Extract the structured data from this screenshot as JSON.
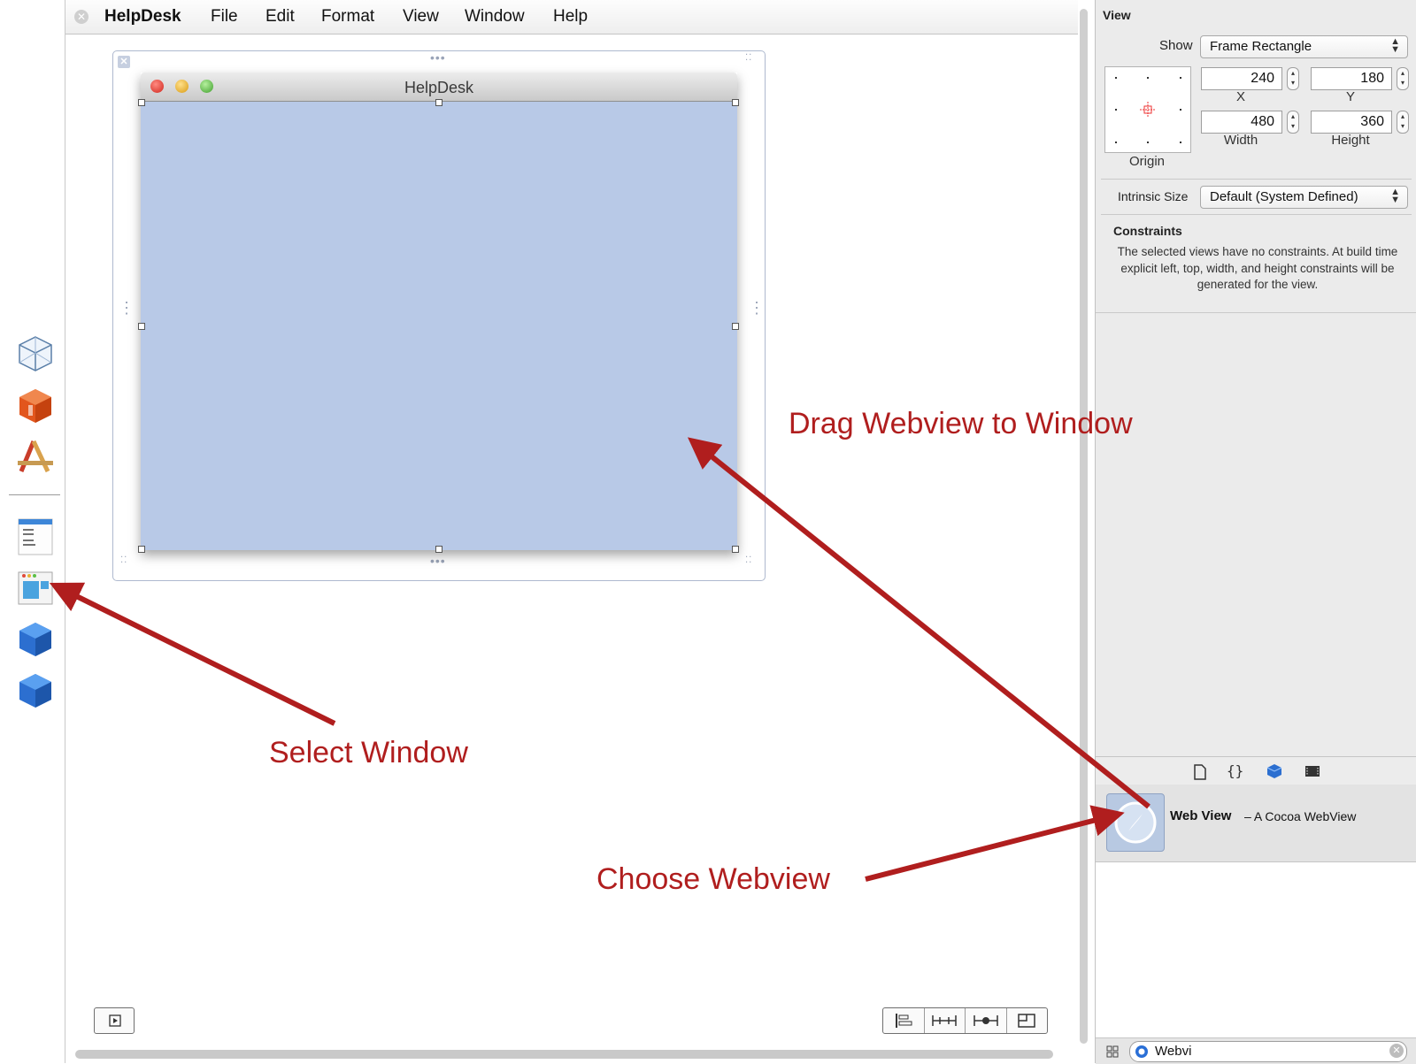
{
  "menubar": {
    "app_name": "HelpDesk",
    "items": [
      "File",
      "Edit",
      "Format",
      "View",
      "Window",
      "Help"
    ]
  },
  "window": {
    "title": "HelpDesk"
  },
  "inspector": {
    "section_title": "View",
    "show_label": "Show",
    "show_value": "Frame Rectangle",
    "x_value": "240",
    "y_value": "180",
    "width_value": "480",
    "height_value": "360",
    "x_label": "X",
    "y_label": "Y",
    "width_label": "Width",
    "height_label": "Height",
    "origin_label": "Origin",
    "intrinsic_label": "Intrinsic Size",
    "intrinsic_value": "Default (System Defined)",
    "constraints_title": "Constraints",
    "constraints_text": "The selected views have no constraints. At build time explicit left, top, width, and height constraints will be generated for the view."
  },
  "library": {
    "item_name": "Web View",
    "item_desc": "– A Cocoa WebView",
    "search_value": "Webvi"
  },
  "annotations": {
    "drag": "Drag Webview to Window",
    "select": "Select Window",
    "choose": "Choose Webview",
    "color": "#b01e1e"
  },
  "icons": {
    "dock": [
      "cube-outline-icon",
      "orange-cube-icon",
      "app-store-icon",
      "main-menu-icon",
      "window-icon",
      "blue-cube-icon",
      "blue-cube-icon"
    ],
    "library_tabs": [
      "file-template-icon",
      "code-snippet-icon",
      "object-library-icon",
      "media-library-icon"
    ]
  }
}
